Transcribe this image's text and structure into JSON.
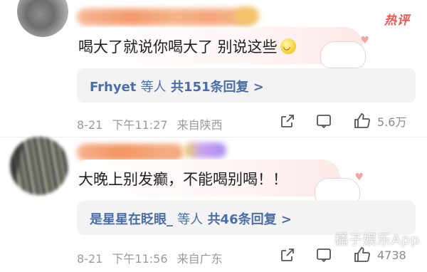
{
  "comments": [
    {
      "hot_tag": "热评",
      "text": "喝大了就说你喝大了 别说这些",
      "replies": {
        "names": "Frhyet",
        "suffix": "等人",
        "count_text": "共151条回复 >"
      },
      "meta": {
        "date": "8-21",
        "time": "下午11:27",
        "location": "来自陕西"
      },
      "likes": "5.6万"
    },
    {
      "text": "大晚上别发癫，不能喝别喝！！",
      "replies": {
        "names": "是星星在眨眼_",
        "suffix": "等人",
        "count_text": "共46条回复 >"
      },
      "meta": {
        "date": "8-21",
        "time": "下午11:56",
        "location": "来自广东"
      },
      "likes": "4738"
    }
  ],
  "watermark": "橘子娱乐App",
  "colors": {
    "reply_link": "#4a6fa8",
    "meta_gray": "#9a9a9a",
    "hot_red": "#f0544f",
    "reply_bg": "#f3f3f3"
  },
  "icons": [
    "share-icon",
    "comment-icon",
    "like-icon",
    "smile-emoji-icon"
  ]
}
